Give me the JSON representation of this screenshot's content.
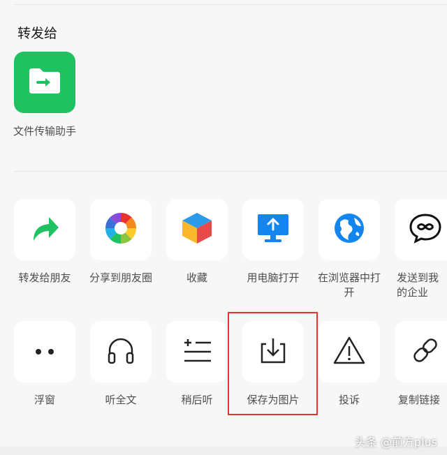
{
  "forward_section": {
    "title": "转发给",
    "contact": {
      "label": "文件传输助手",
      "icon": "folder-arrow-icon"
    }
  },
  "share_row": [
    {
      "label": "转发给朋友",
      "icon": "share-arrow-icon"
    },
    {
      "label": "分享到朋友圈",
      "icon": "moments-icon"
    },
    {
      "label": "收藏",
      "icon": "favorite-cube-icon"
    },
    {
      "label": "用电脑打开",
      "icon": "computer-open-icon"
    },
    {
      "label": "在浏览器中打开",
      "icon": "browser-globe-icon"
    },
    {
      "label": "发送到我的企业",
      "icon": "wecom-icon"
    }
  ],
  "action_row": [
    {
      "label": "浮窗",
      "icon": "float-window-icon"
    },
    {
      "label": "听全文",
      "icon": "headphones-icon"
    },
    {
      "label": "稍后听",
      "icon": "listen-later-icon"
    },
    {
      "label": "保存为图片",
      "icon": "save-image-icon"
    },
    {
      "label": "投诉",
      "icon": "warning-icon"
    },
    {
      "label": "复制链接",
      "icon": "link-icon"
    }
  ],
  "watermark": "头条 @前方plus",
  "colors": {
    "wechat_green": "#20c160",
    "highlight_red": "#e8322e",
    "icon_blue": "#1485ee"
  }
}
